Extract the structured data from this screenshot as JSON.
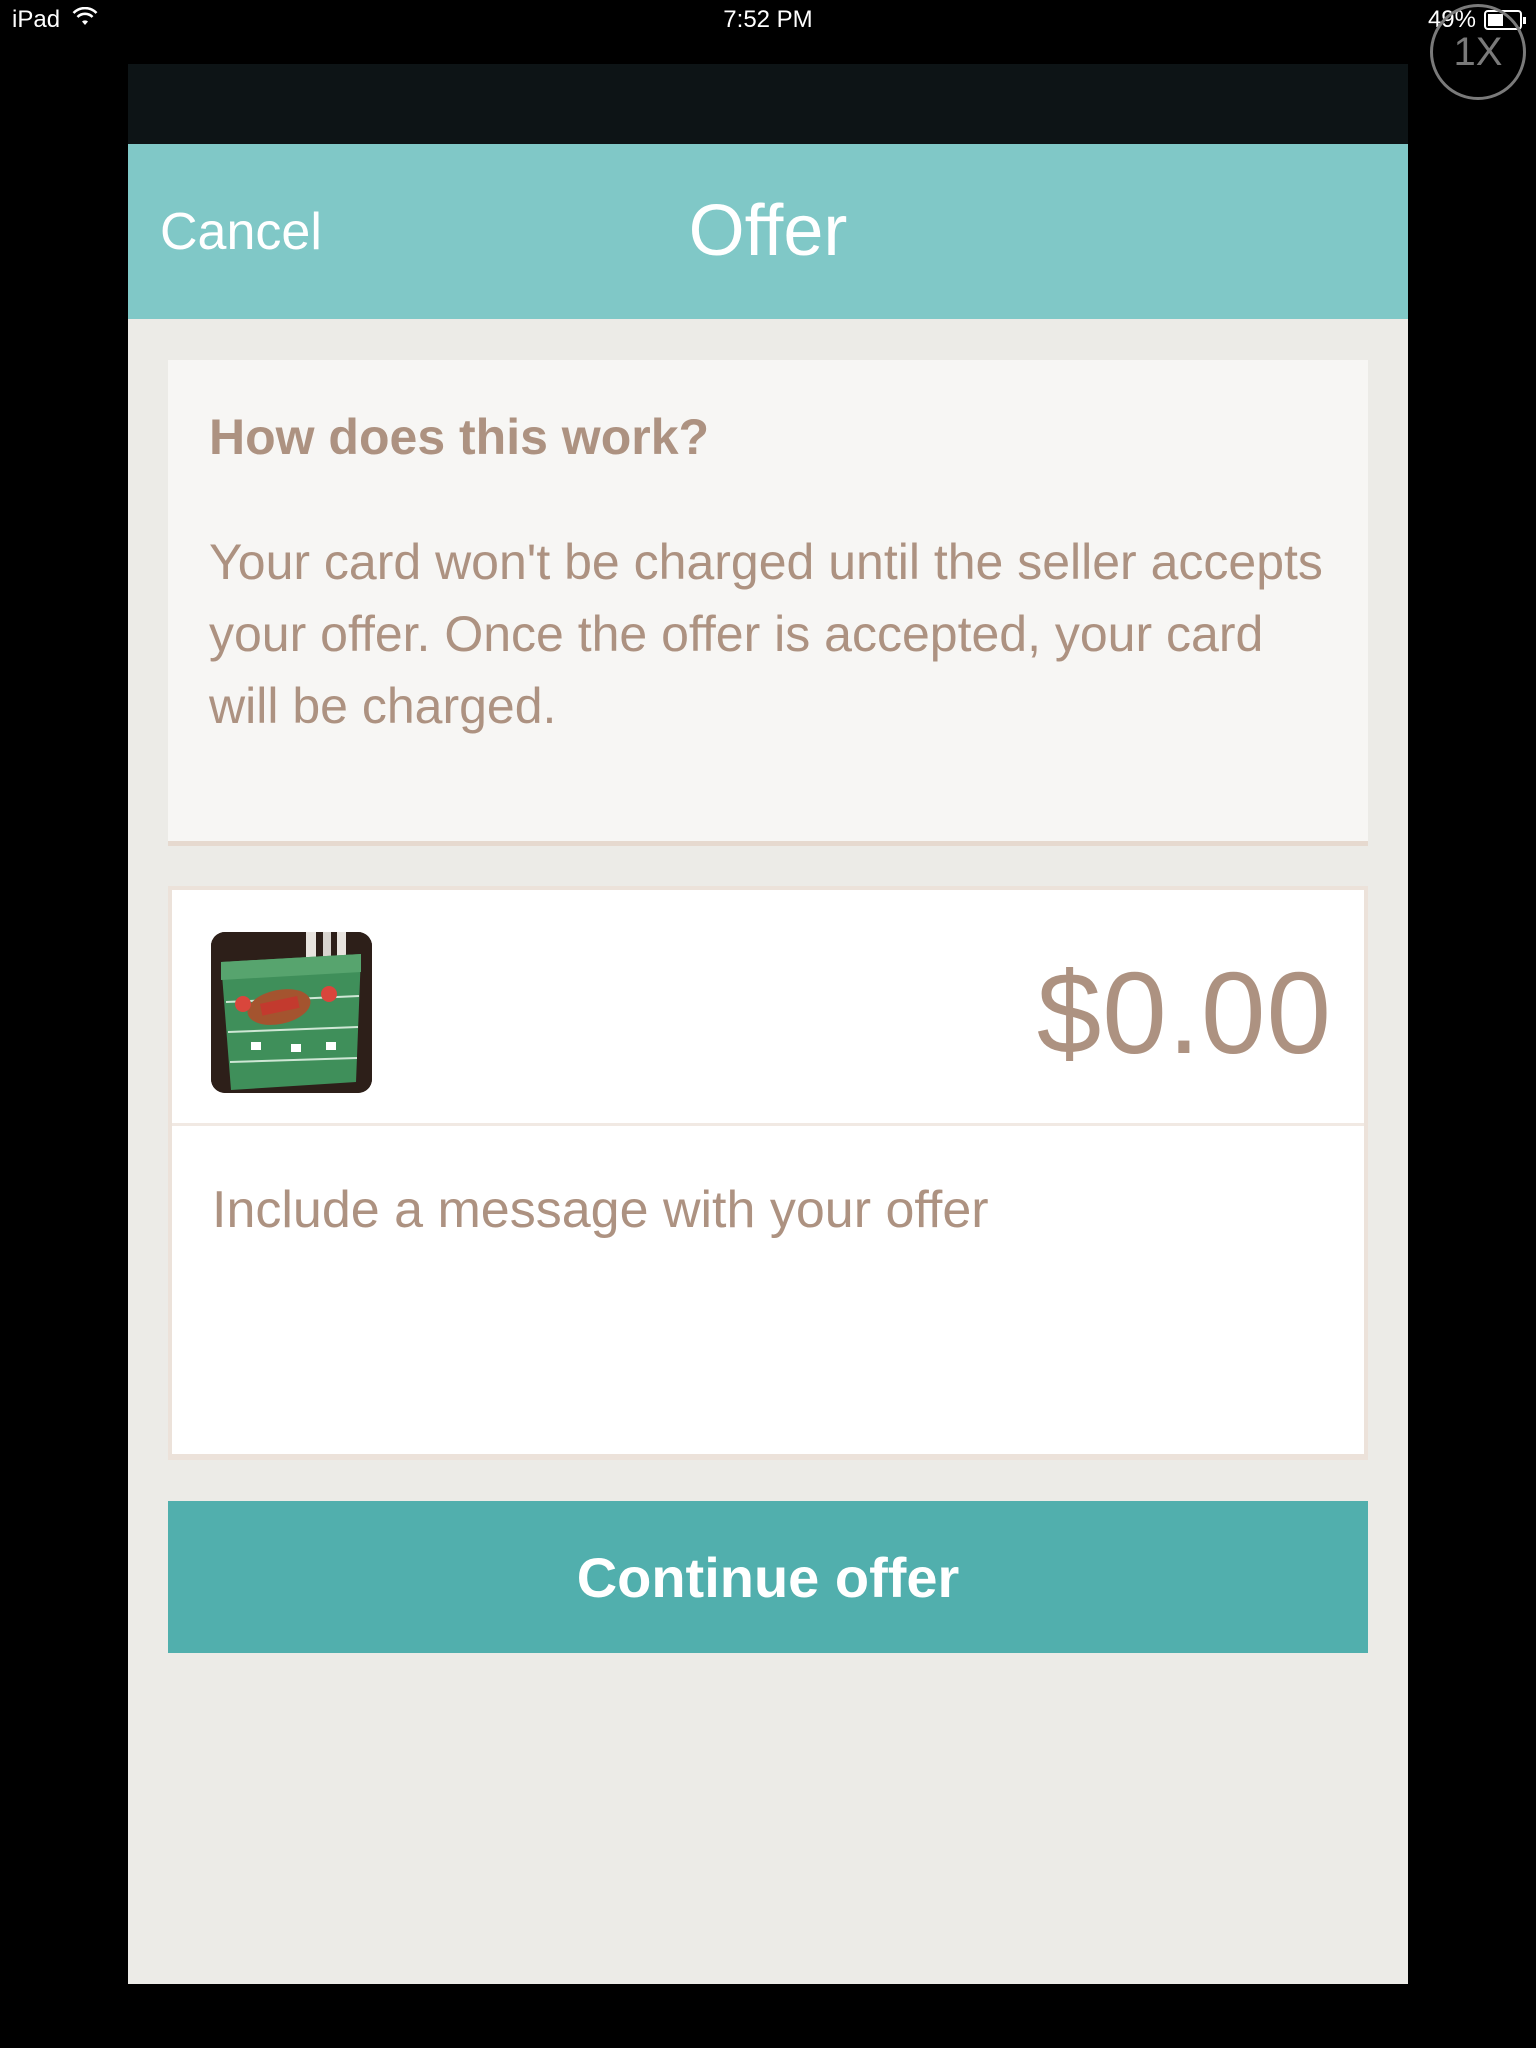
{
  "status_bar": {
    "device": "iPad",
    "time": "7:52 PM",
    "battery_percent_label": "49%",
    "battery_level": 0.49,
    "zoom_badge": "1X"
  },
  "nav": {
    "cancel_label": "Cancel",
    "title": "Offer"
  },
  "info": {
    "heading": "How does this work?",
    "body": "Your card won't be charged until the seller accepts your offer. Once the offer is accepted, your card will be charged."
  },
  "offer": {
    "price": "$0.00",
    "message_placeholder": "Include a message with your offer"
  },
  "actions": {
    "continue_label": "Continue offer"
  },
  "colors": {
    "nav_teal": "#80c8c7",
    "button_teal": "#51afad",
    "text_tan": "#ad9281",
    "background": "#ecebe7"
  }
}
